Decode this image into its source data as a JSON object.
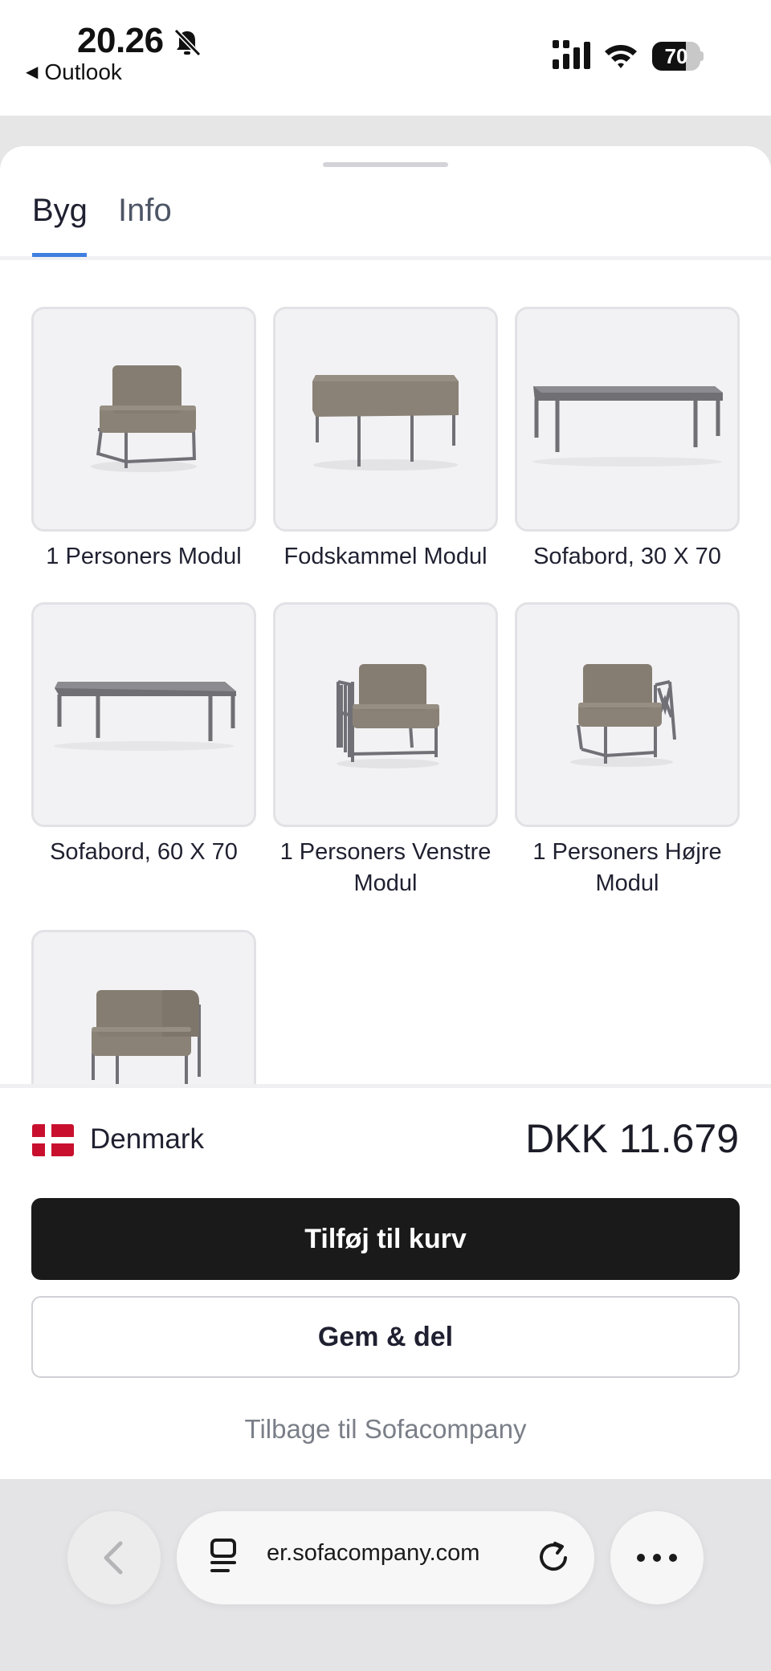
{
  "status_bar": {
    "time": "20.26",
    "back_app": "Outlook",
    "battery": "70",
    "battery_level": 0.7
  },
  "tabs": [
    {
      "label": "Byg",
      "active": true
    },
    {
      "label": "Info",
      "active": false
    }
  ],
  "products": [
    {
      "label": "1 Personers Modul"
    },
    {
      "label": "Fodskammel Modul"
    },
    {
      "label": "Sofabord, 30 X 70"
    },
    {
      "label": "Sofabord, 60 X 70"
    },
    {
      "label": "1 Personers Venstre Modul"
    },
    {
      "label": "1 Personers Højre Modul"
    },
    {
      "label": ""
    }
  ],
  "footer": {
    "country": "Denmark",
    "price": "DKK 11.679",
    "add_to_cart": "Tilføj til kurv",
    "save_share": "Gem & del",
    "back_link": "Tilbage til Sofacompany"
  },
  "browser": {
    "url": "er.sofacompany.com"
  },
  "colors": {
    "accent": "#3f7fe0",
    "primary_button": "#1a1a1a",
    "fabric": "#8a8276",
    "frame": "#6f6f74"
  }
}
